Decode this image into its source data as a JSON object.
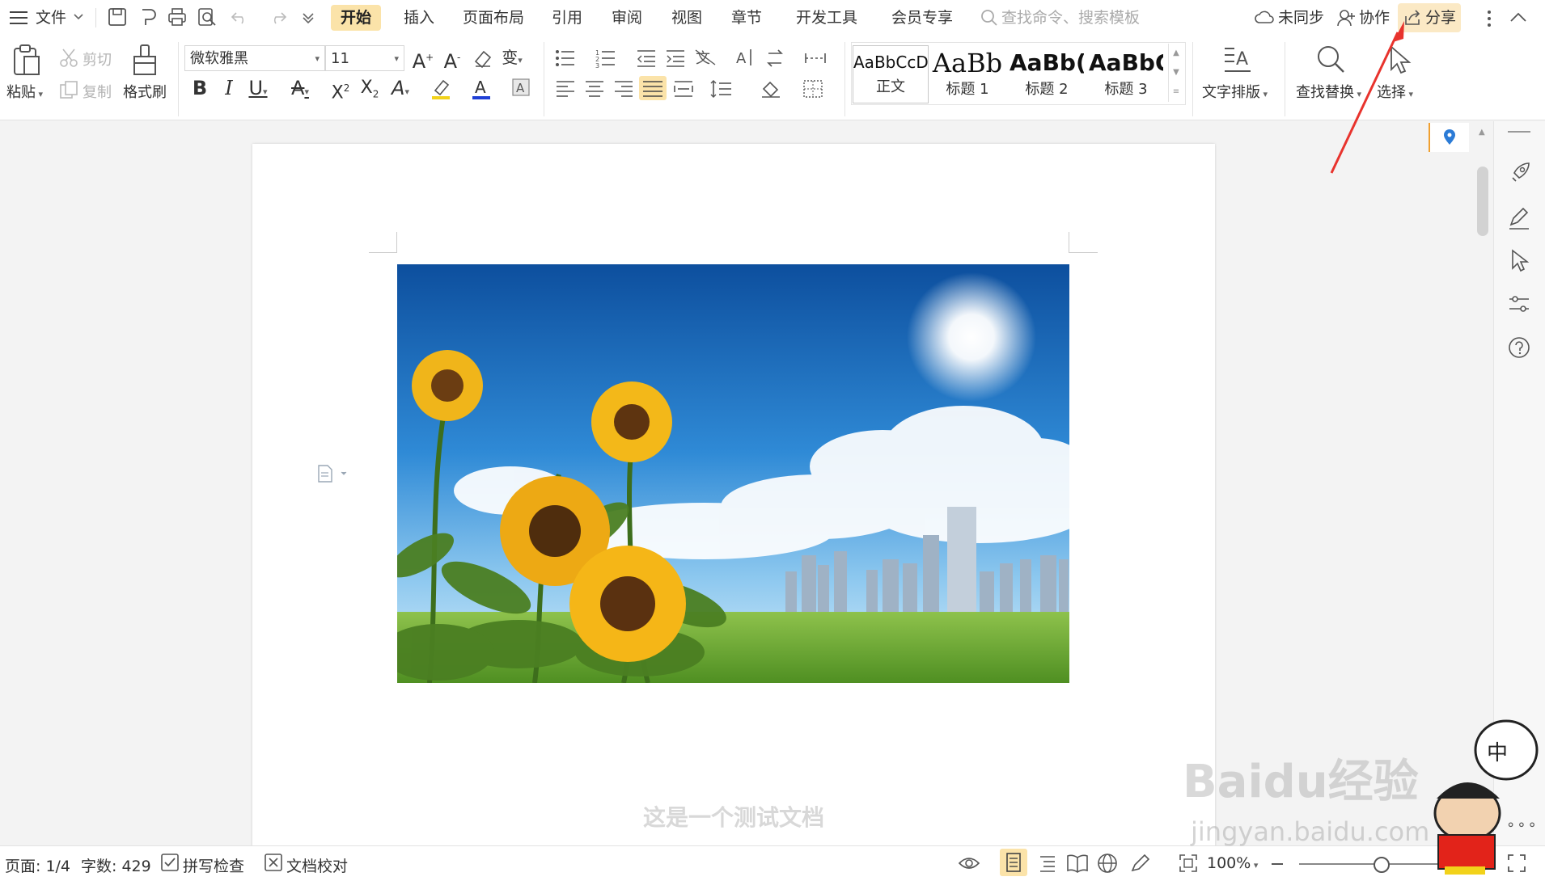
{
  "menubar": {
    "file_label": "文件",
    "tabs": [
      "开始",
      "插入",
      "页面布局",
      "引用",
      "审阅",
      "视图",
      "章节",
      "开发工具",
      "会员专享"
    ],
    "active_tab": "开始",
    "search_placeholder": "查找命令、搜索模板",
    "sync_label": "未同步",
    "collab_label": "协作",
    "share_label": "分享"
  },
  "ribbon": {
    "paste_label": "粘贴",
    "cut_label": "剪切",
    "copy_label": "复制",
    "format_painter_label": "格式刷",
    "font_name": "微软雅黑",
    "font_size": "11",
    "styles": [
      {
        "sample": "AaBbCcDd",
        "name": "正文"
      },
      {
        "sample": "AaBb",
        "name": "标题 1"
      },
      {
        "sample": "AaBb(",
        "name": "标题 2"
      },
      {
        "sample": "AaBbC",
        "name": "标题 3"
      }
    ],
    "text_layout_label": "文字排版",
    "find_replace_label": "查找替换",
    "select_label": "选择"
  },
  "document": {
    "body_text": "这是一个测试文档"
  },
  "statusbar": {
    "page": "页面: 1/4",
    "word_count": "字数: 429",
    "spell_check": "拼写检查",
    "doc_review": "文档校对",
    "zoom": "100%"
  },
  "watermark": {
    "brand": "Baidu经验",
    "url": "jingyan.baidu.com"
  },
  "colors": {
    "active_tab_bg": "#fbe3a9",
    "share_bg": "#fbe9c5",
    "annotation_arrow": "#e8332d",
    "font_color_bar": "#1f3fd6",
    "highlight_bar": "#f2d21a"
  }
}
